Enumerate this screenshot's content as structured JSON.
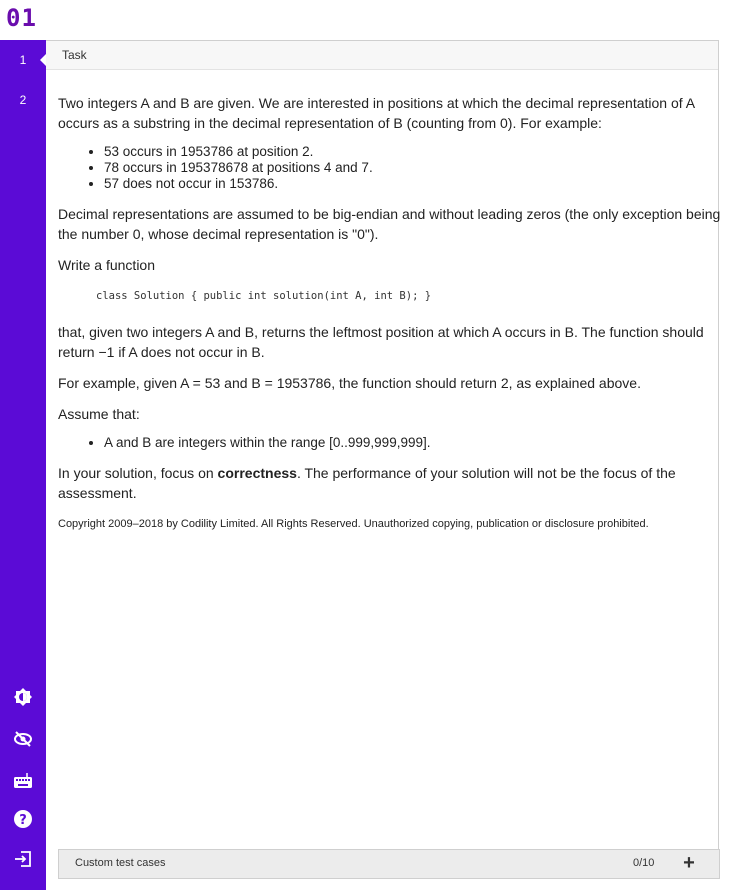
{
  "app": {
    "logo": "01"
  },
  "sidebar": {
    "items": [
      {
        "label": "1"
      },
      {
        "label": "2"
      }
    ],
    "icons": [
      "theme-icon",
      "hide-icon",
      "keyboard-icon",
      "help-icon",
      "exit-icon"
    ]
  },
  "panel": {
    "title": "Task"
  },
  "task": {
    "intro": "Two integers A and B are given. We are interested in positions at which the decimal representation of A occurs as a substring in the decimal representation of B (counting from 0). For example:",
    "examples": [
      "53 occurs in 1953786 at position 2.",
      "78 occurs in 195378678 at positions 4 and 7.",
      "57 does not occur in 153786."
    ],
    "representation": "Decimal representations are assumed to be big-endian and without leading zeros (the only exception being the number 0, whose decimal representation is \"0\").",
    "write_function": "Write a function",
    "code": "class Solution { public int solution(int A, int B); }",
    "returns": "that, given two integers A and B, returns the leftmost position at which A occurs in B. The function should return −1 if A does not occur in B.",
    "example_text": "For example, given A = 53 and B = 1953786, the function should return 2, as explained above.",
    "assume": "Assume that:",
    "assumptions": [
      "A and B are integers within the range [0..999,999,999]."
    ],
    "focus_prefix": "In your solution, focus on ",
    "focus_bold": "correctness",
    "focus_suffix": ". The performance of your solution will not be the focus of the assessment.",
    "copyright": "Copyright 2009–2018 by Codility Limited. All Rights Reserved. Unauthorized copying, publication or disclosure prohibited."
  },
  "footer": {
    "label": "Custom test cases",
    "count": "0/10",
    "add": "+"
  },
  "colors": {
    "sidebar": "#5b0bd6",
    "logo": "#6a0dad"
  }
}
